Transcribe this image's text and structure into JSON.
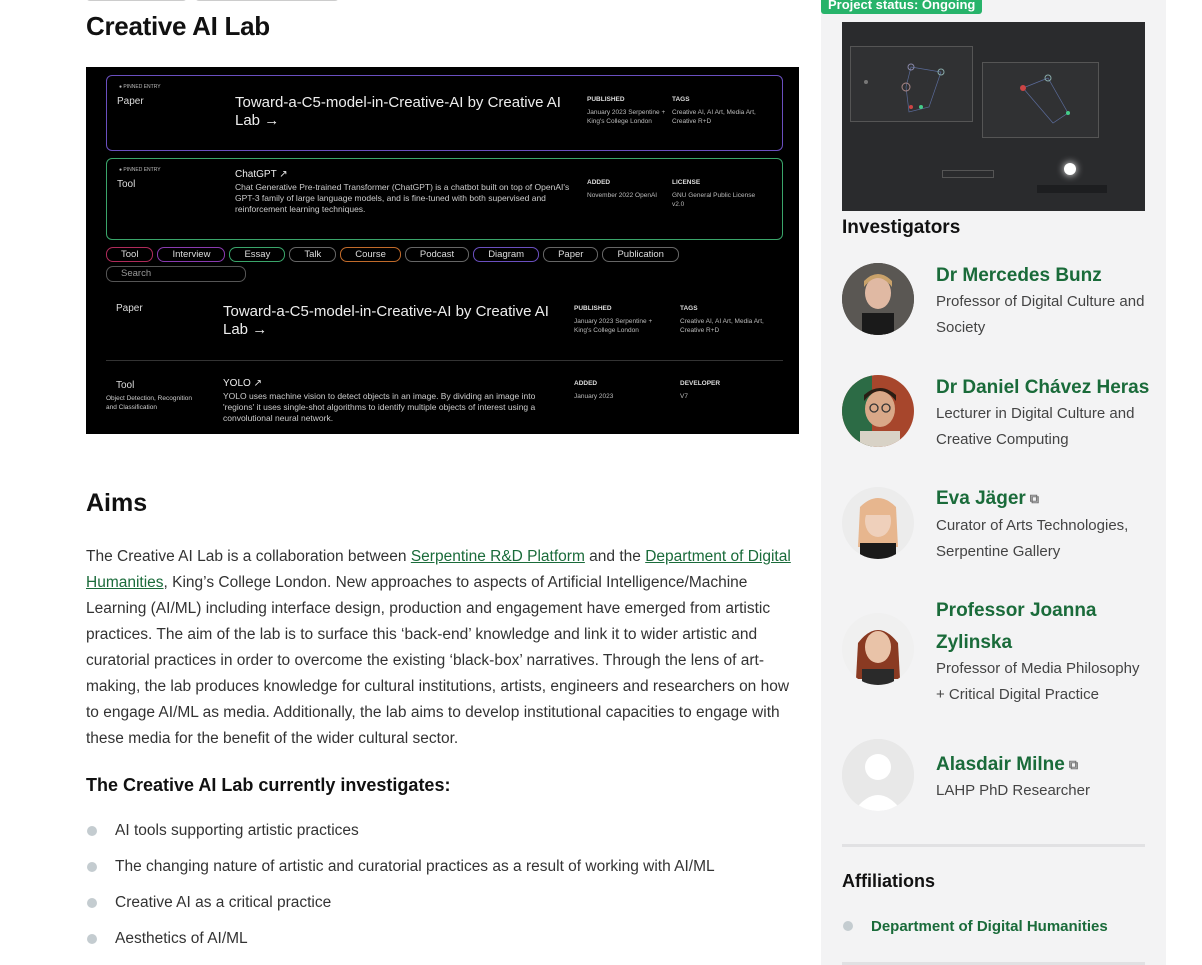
{
  "page": {
    "title": "Creative AI Lab"
  },
  "hero": {
    "rows": [
      {
        "pinned": "● PINNED ENTRY",
        "kind": "Paper",
        "title": "Toward-a-C5-model-in-Creative-AI by Creative AI Lab →",
        "meta1_h": "PUBLISHED",
        "meta1_v": "January 2023 Serpentine + King's College London",
        "meta2_h": "TAGS",
        "meta2_v": "Creative AI, AI Art, Media Art, Creative R+D"
      },
      {
        "pinned": "● PINNED ENTRY",
        "kind": "Tool",
        "title": "ChatGPT ↗",
        "desc": "Chat Generative Pre-trained Transformer (ChatGPT) is a chatbot built on top of OpenAI's GPT-3 family of large language models, and is fine-tuned with both supervised and reinforcement learning techniques.",
        "meta1_h": "ADDED",
        "meta1_v": "November 2022 OpenAI",
        "meta2_h": "LICENSE",
        "meta2_v": "GNU General Public License v2.0"
      },
      {
        "kind": "Paper",
        "title": "Toward-a-C5-model-in-Creative-AI by Creative AI Lab →",
        "meta1_h": "PUBLISHED",
        "meta1_v": "January 2023 Serpentine + King's College London",
        "meta2_h": "TAGS",
        "meta2_v": "Creative AI, AI Art, Media Art, Creative R+D"
      },
      {
        "kind": "Tool",
        "subkind": "Object Detection, Recognition and Classification",
        "title": "YOLO ↗",
        "desc": "YOLO uses machine vision to detect objects in an image. By dividing an image into 'regions' it uses single-shot algorithms to identify multiple objects of interest using a convolutional neural network.",
        "meta1_h": "ADDED",
        "meta1_v": "January 2023",
        "meta2_h": "DEVELOPER",
        "meta2_v": "V7"
      }
    ],
    "filters": [
      "Tool",
      "Interview",
      "Essay",
      "Talk",
      "Course",
      "Podcast",
      "Diagram",
      "Paper",
      "Publication"
    ],
    "search_label": "Search"
  },
  "aims": {
    "heading": "Aims",
    "p_start": "The Creative AI Lab is a collaboration between ",
    "link1": "Serpentine R&D Platform",
    "p_mid": " and the ",
    "link2": "Department of Digital Humanities",
    "p_end": ", King’s College London. New approaches to aspects of Artificial Intelligence/Machine Learning (AI/ML) including interface design, production and engagement have emerged from artistic practices. The aim of the lab is to surface this ‘back-end’ knowledge and link it to wider artistic and curatorial practices in order to overcome the existing ‘black-box’ narratives. Through the lens of art-making, the lab produces knowledge for cultural institutions, artists, engineers and researchers on how to engage AI/ML as media. Additionally, the lab aims to develop institutional capacities to engage with these media for the benefit of the wider cultural sector."
  },
  "investigates": {
    "heading": "The Creative AI Lab currently investigates:",
    "items": [
      "AI tools supporting artistic practices",
      "The changing nature of artistic and curatorial practices as a result of working with AI/ML",
      "Creative AI as a critical practice",
      "Aesthetics of AI/ML"
    ]
  },
  "sidebar": {
    "status": "Project status: Ongoing",
    "investigators_heading": "Investigators",
    "people": [
      {
        "name": "Dr Mercedes Bunz",
        "role": "Professor of Digital Culture and Society",
        "external": false
      },
      {
        "name": "Dr Daniel Chávez Heras",
        "role": "Lecturer in Digital Culture and Creative Computing",
        "external": false
      },
      {
        "name": "Eva Jäger",
        "role": "Curator of Arts Technologies, Serpentine Gallery",
        "external": true
      },
      {
        "name": "Professor Joanna Zylinska",
        "role": "Professor of Media Philosophy + Critical Digital Practice",
        "external": false
      },
      {
        "name": "Alasdair Milne",
        "role": "LAHP PhD Researcher",
        "external": true
      }
    ],
    "external_icon": "external-link-icon",
    "affiliations_heading": "Affiliations",
    "affiliations": [
      "Department of Digital Humanities"
    ]
  },
  "colors": {
    "link_green": "#1a6b3a",
    "status_green": "#27b36a",
    "sidebar_bg": "#f3f3f4"
  }
}
